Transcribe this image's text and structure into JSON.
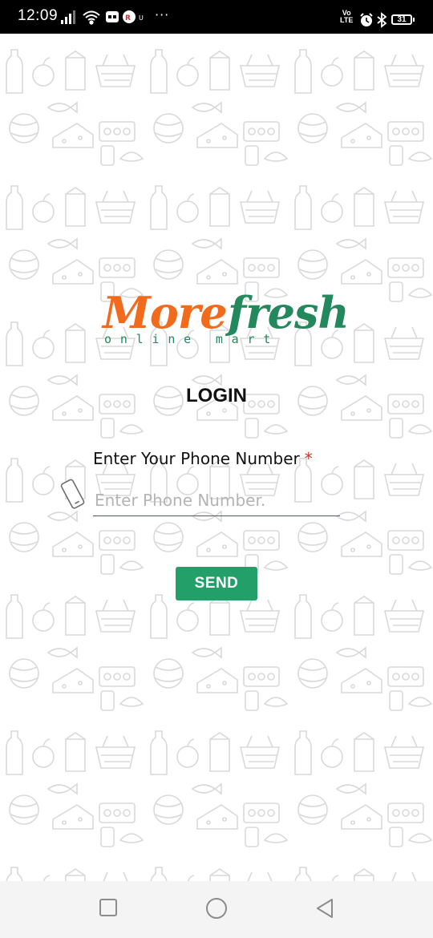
{
  "status_bar": {
    "time": "12:09",
    "more_indicator": "···",
    "volte_top": "Vo",
    "volte_bottom": "LTE",
    "battery": "31",
    "icons": [
      "signal-icon",
      "wifi-icon",
      "message-app-icon",
      "app-notification-icon",
      "small-app-icon",
      "alarm-icon",
      "bluetooth-icon",
      "battery-icon"
    ]
  },
  "logo": {
    "word1": "More",
    "word2": "fresh",
    "tagline": "online mart",
    "colors": {
      "more": "#f26a1c",
      "fresh": "#23885c"
    }
  },
  "login": {
    "title": "LOGIN",
    "phone_label": "Enter Your Phone Number",
    "required_mark": "*",
    "phone_placeholder": "Enter Phone Number.",
    "phone_value": "",
    "send_label": "SEND"
  },
  "nav_bar": {
    "buttons": [
      "recent-apps-button",
      "home-button",
      "back-button"
    ]
  },
  "colors": {
    "accent_green": "#23a06a",
    "brand_orange": "#f26a1c",
    "brand_green": "#23885c",
    "required_red": "#d32f2f"
  }
}
